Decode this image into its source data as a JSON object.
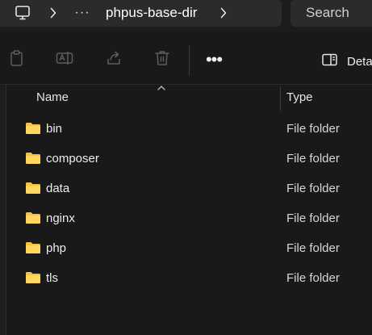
{
  "address_bar": {
    "root_icon": "this-pc-icon",
    "overflow_label": "···",
    "current_folder": "phpus-base-dir"
  },
  "search": {
    "placeholder": "Search"
  },
  "command_bar": {
    "buttons": [
      {
        "icon": "copy-icon"
      },
      {
        "icon": "rename-icon"
      },
      {
        "icon": "share-icon"
      },
      {
        "icon": "delete-icon"
      }
    ],
    "more_label": "•••",
    "details_label": "Deta"
  },
  "columns": {
    "name": "Name",
    "type": "Type"
  },
  "files": [
    {
      "name": "bin",
      "type": "File folder"
    },
    {
      "name": "composer",
      "type": "File folder"
    },
    {
      "name": "data",
      "type": "File folder"
    },
    {
      "name": "nginx",
      "type": "File folder"
    },
    {
      "name": "php",
      "type": "File folder"
    },
    {
      "name": "tls",
      "type": "File folder"
    }
  ],
  "colors": {
    "folder": "#f5c242",
    "background": "#191919",
    "bar": "#2b2b2b"
  }
}
